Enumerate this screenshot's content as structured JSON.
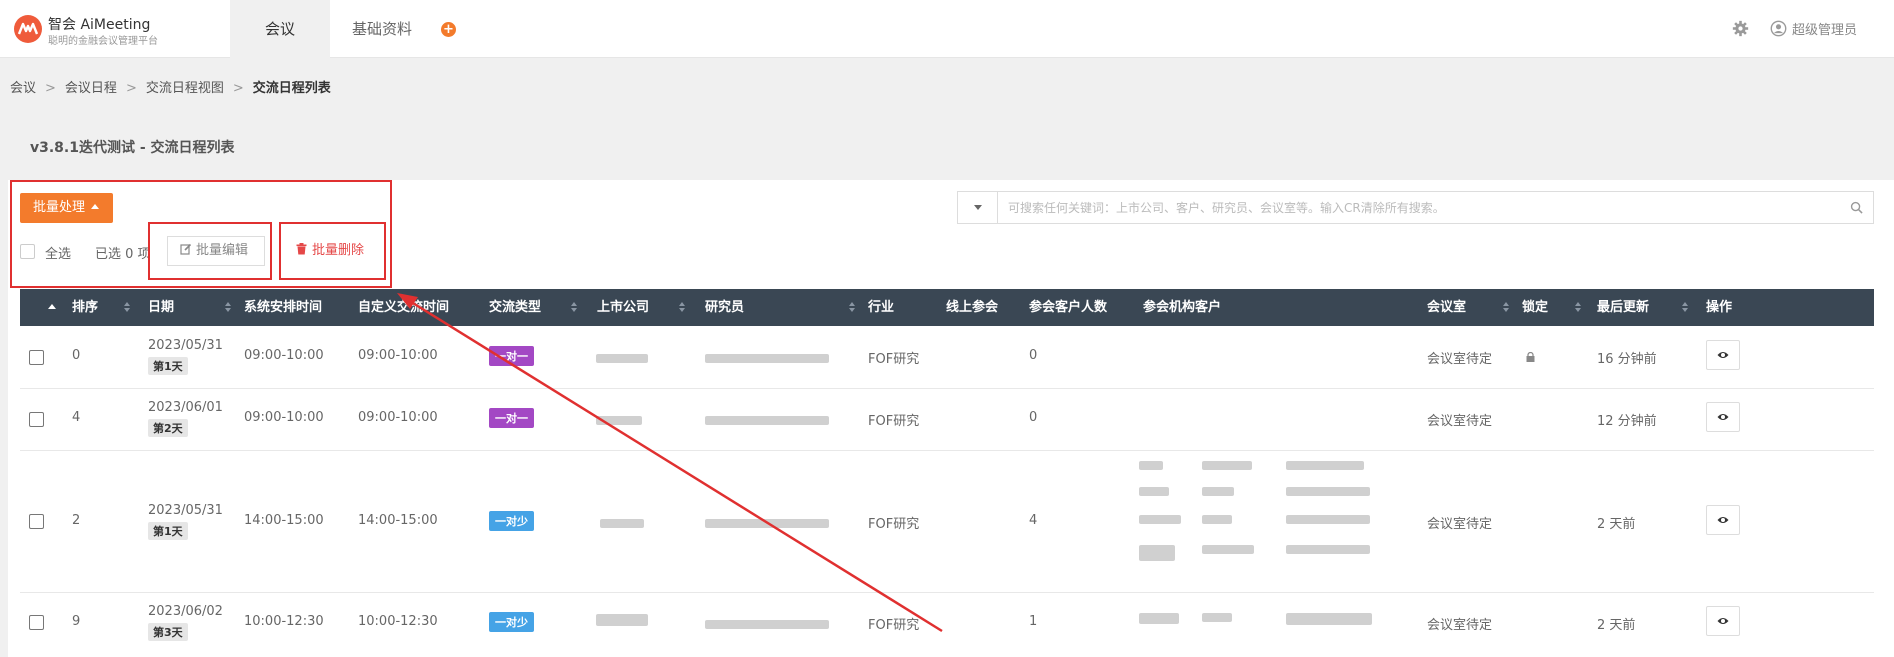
{
  "app": {
    "brand": "智会 AiMeeting",
    "tagline": "聪明的金融会议管理平台",
    "logo_text": "AM"
  },
  "nav": {
    "tabs": [
      {
        "label": "会议",
        "active": true
      },
      {
        "label": "基础资料",
        "active": false
      }
    ],
    "add_icon": "plus-circle-icon",
    "settings_icon": "gear-icon",
    "user_icon": "user-circle-icon",
    "user_name": "超级管理员"
  },
  "breadcrumb": [
    "会议",
    "会议日程",
    "交流日程视图",
    "交流日程列表"
  ],
  "page_title": "v3.8.1迭代测试 - 交流日程列表",
  "toolbar": {
    "batch_label": "批量处理",
    "select_all_label": "全选",
    "selected_count": "已选 0 项",
    "batch_edit_label": "批量编辑",
    "batch_delete_label": "批量删除"
  },
  "search": {
    "placeholder": "可搜索任何关键词：上市公司、客户、研究员、会议室等。输入CR清除所有搜索。"
  },
  "colors": {
    "accent": "#f37b2c",
    "header_bg": "#3a4754",
    "type_one_to_one": "#a348c4",
    "type_one_to_few": "#45a3e6",
    "danger": "#e54848",
    "annotation": "#e03030"
  },
  "table": {
    "headers": [
      "排序",
      "日期",
      "系统安排时间",
      "自定义交流时间",
      "交流类型",
      "上市公司",
      "研究员",
      "行业",
      "线上参会",
      "参会客户人数",
      "参会机构客户",
      "会议室",
      "锁定",
      "最后更新",
      "操作"
    ],
    "rows": [
      {
        "order": "0",
        "date": "2023/05/31",
        "day": "第1天",
        "sys_time": "09:00-10:00",
        "custom_time": "09:00-10:00",
        "type": "一对一",
        "type_color": "#a348c4",
        "industry": "FOF研究",
        "client_count": "0",
        "room": "会议室待定",
        "locked": true,
        "updated": "16 分钟前"
      },
      {
        "order": "4",
        "date": "2023/06/01",
        "day": "第2天",
        "sys_time": "09:00-10:00",
        "custom_time": "09:00-10:00",
        "type": "一对一",
        "type_color": "#a348c4",
        "industry": "FOF研究",
        "client_count": "0",
        "room": "会议室待定",
        "locked": false,
        "updated": "12 分钟前"
      },
      {
        "order": "2",
        "date": "2023/05/31",
        "day": "第1天",
        "sys_time": "14:00-15:00",
        "custom_time": "14:00-15:00",
        "type": "一对少",
        "type_color": "#45a3e6",
        "industry": "FOF研究",
        "client_count": "4",
        "room": "会议室待定",
        "locked": false,
        "updated": "2 天前"
      },
      {
        "order": "9",
        "date": "2023/06/02",
        "day": "第3天",
        "sys_time": "10:00-12:30",
        "custom_time": "10:00-12:30",
        "type": "一对少",
        "type_color": "#45a3e6",
        "industry": "FOF研究",
        "client_count": "1",
        "room": "会议室待定",
        "locked": false,
        "updated": "2 天前"
      }
    ]
  }
}
